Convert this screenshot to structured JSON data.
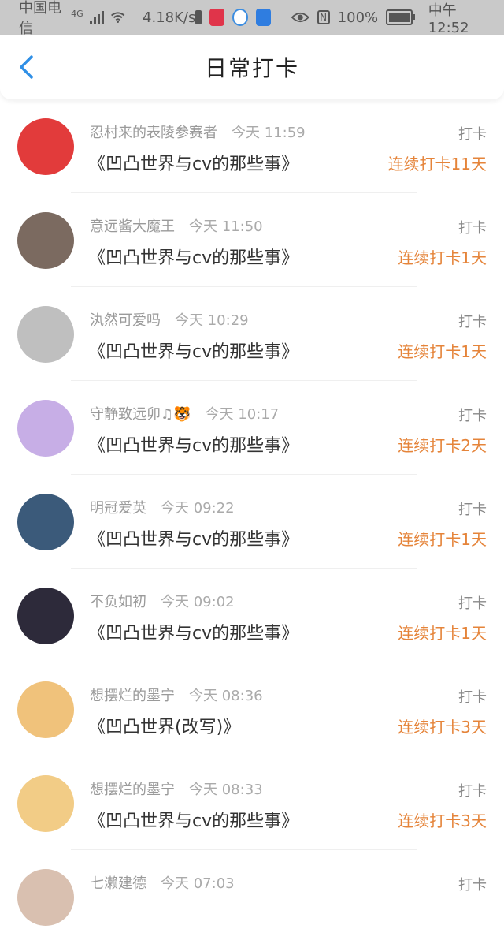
{
  "status_bar": {
    "carrier": "中国电信",
    "network": "4G",
    "speed": "4.18K/s",
    "battery": "100%",
    "time": "中午12:52",
    "colors": {
      "bg": "#c9c9c9",
      "fg": "#555555"
    }
  },
  "header": {
    "title": "日常打卡",
    "back_icon": "chevron-left-icon",
    "back_color": "#2f8fe6"
  },
  "colors": {
    "streak": "#e5843a",
    "action": "#888888",
    "name": "#9a9a9a"
  },
  "items": [
    {
      "name": "忍村来的表陵参赛者",
      "time": "今天 11:59",
      "book": "《凹凸世界与cv的那些事》",
      "action": "打卡",
      "streak": "连续打卡11天",
      "avatar_bg": "#e23b3b"
    },
    {
      "name": "意远酱大魔王",
      "time": "今天 11:50",
      "book": "《凹凸世界与cv的那些事》",
      "action": "打卡",
      "streak": "连续打卡1天",
      "avatar_bg": "#7b6a60"
    },
    {
      "name": "汍然可爱吗",
      "time": "今天 10:29",
      "book": "《凹凸世界与cv的那些事》",
      "action": "打卡",
      "streak": "连续打卡1天",
      "avatar_bg": "#bfbfbf"
    },
    {
      "name": "守静致远卯♫🐯",
      "time": "今天 10:17",
      "book": "《凹凸世界与cv的那些事》",
      "action": "打卡",
      "streak": "连续打卡2天",
      "avatar_bg": "#c7aee6"
    },
    {
      "name": "明冠爱英",
      "time": "今天 09:22",
      "book": "《凹凸世界与cv的那些事》",
      "action": "打卡",
      "streak": "连续打卡1天",
      "avatar_bg": "#3b5a7a"
    },
    {
      "name": "不负如初",
      "time": "今天 09:02",
      "book": "《凹凸世界与cv的那些事》",
      "action": "打卡",
      "streak": "连续打卡1天",
      "avatar_bg": "#2d2a3a"
    },
    {
      "name": "想摆烂的墨宁",
      "time": "今天 08:36",
      "book": "《凹凸世界(改写)》",
      "action": "打卡",
      "streak": "连续打卡3天",
      "avatar_bg": "#f0c27b"
    },
    {
      "name": "想摆烂的墨宁",
      "time": "今天 08:33",
      "book": "《凹凸世界与cv的那些事》",
      "action": "打卡",
      "streak": "连续打卡3天",
      "avatar_bg": "#f2cc86"
    },
    {
      "name": "七濑建德",
      "time": "今天 07:03",
      "book": "",
      "action": "打卡",
      "streak": "",
      "avatar_bg": "#d9c0b0"
    }
  ]
}
